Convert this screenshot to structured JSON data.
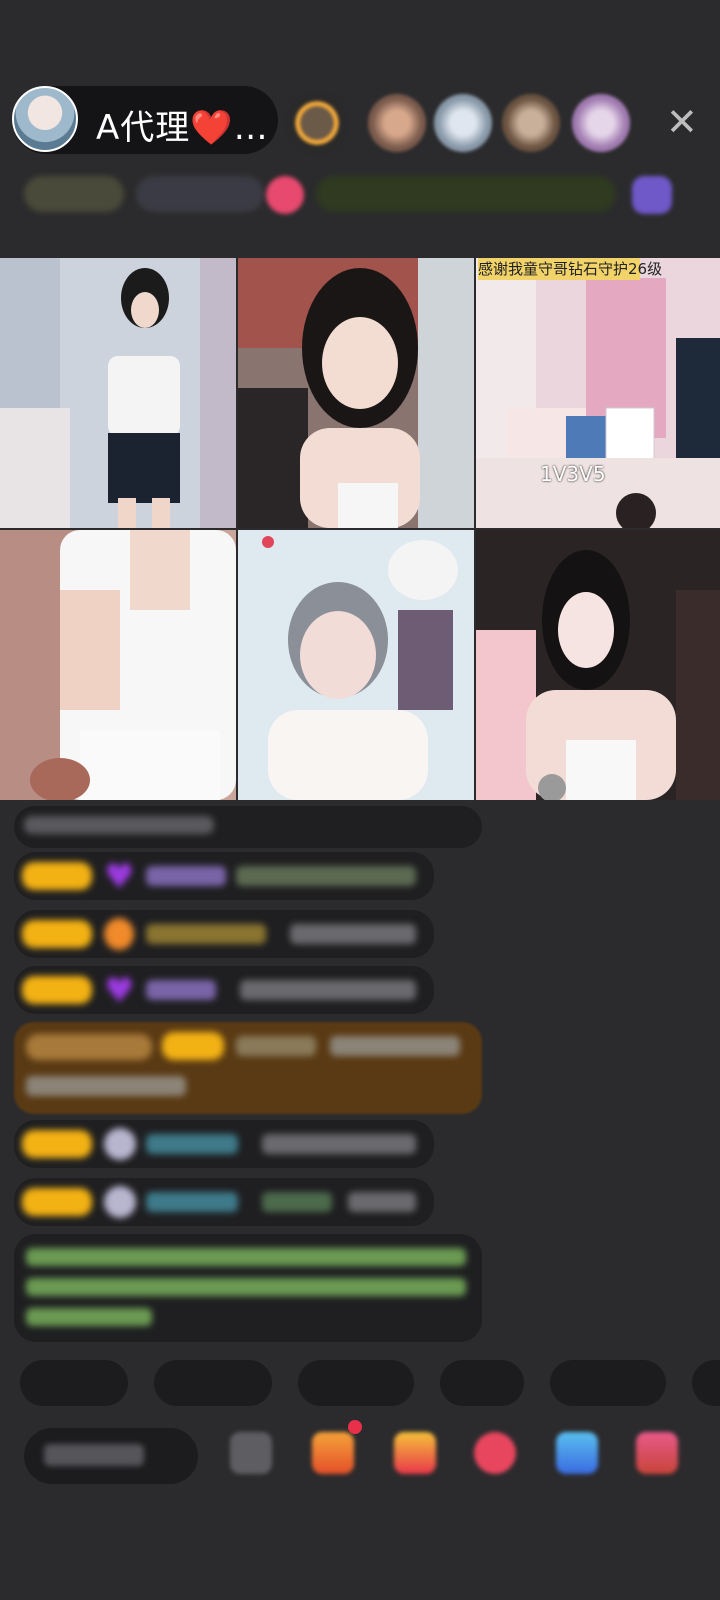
{
  "header": {
    "host_name": "A代理❤️…",
    "close_icon": "close-icon"
  },
  "video_grid": {
    "caption": "感谢我童守哥钻石守护26级",
    "score": "1V3V5"
  },
  "colors": {
    "background": "#2b2b2d",
    "badge_yellow": "#f3b214",
    "accent_purple": "#9b3be0",
    "highlight_brown": "#5a3a14",
    "text_green": "#86c26a"
  },
  "chat": {
    "system_line": "",
    "messages": [
      "",
      "",
      "",
      "",
      "",
      "",
      ""
    ]
  },
  "quick_replies": [
    "",
    "",
    "",
    "",
    ""
  ],
  "input": {
    "placeholder": ""
  },
  "icons": [
    "gift-icon",
    "share-icon",
    "shop-icon",
    "heart-icon",
    "game-icon",
    "more-icon"
  ]
}
